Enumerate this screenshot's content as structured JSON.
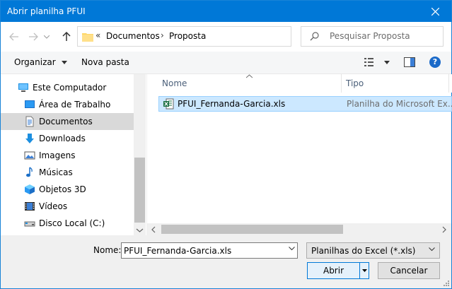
{
  "window": {
    "title": "Abrir planilha PFUI"
  },
  "address": {
    "overflow": "«",
    "crumbs": [
      "Documentos",
      "Proposta"
    ],
    "separator": "›"
  },
  "search": {
    "placeholder": "Pesquisar Proposta"
  },
  "toolbar": {
    "organize_label": "Organizar",
    "new_folder_label": "Nova pasta",
    "help_label": "?"
  },
  "nav": {
    "items": [
      {
        "label": "Este Computador",
        "icon": "computer-icon"
      },
      {
        "label": "Área de Trabalho",
        "icon": "desktop-icon"
      },
      {
        "label": "Documentos",
        "icon": "documents-icon",
        "selected": true
      },
      {
        "label": "Downloads",
        "icon": "download-icon"
      },
      {
        "label": "Imagens",
        "icon": "pictures-icon"
      },
      {
        "label": "Músicas",
        "icon": "music-icon"
      },
      {
        "label": "Objetos 3D",
        "icon": "objects-3d-icon"
      },
      {
        "label": "Vídeos",
        "icon": "videos-icon"
      },
      {
        "label": "Disco Local (C:)",
        "icon": "drive-icon"
      }
    ]
  },
  "columns": {
    "name": "Nome",
    "type": "Tipo"
  },
  "files": [
    {
      "name": "PFUI_Fernanda-Garcia.xls",
      "type": "Planilha do Microsoft Ex...",
      "icon": "excel-file-icon"
    }
  ],
  "footer": {
    "name_label": "Nome:",
    "name_value": "PFUI_Fernanda-Garcia.xls",
    "filter_value": "Planilhas do Excel  (*.xls)",
    "open_label": "Abrir",
    "cancel_label": "Cancelar"
  },
  "colors": {
    "titlebar": "#0078d7",
    "selection": "#cce8ff",
    "selected_nav": "#d9d9d9"
  }
}
